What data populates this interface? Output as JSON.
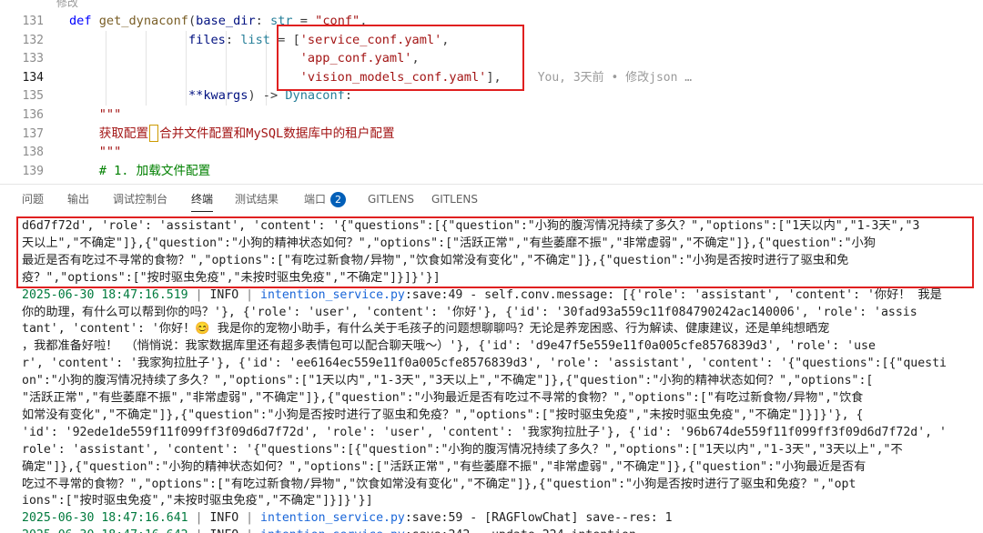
{
  "editor": {
    "top_fragment": "修改",
    "lines": [
      {
        "no": "131",
        "active": false,
        "tokens": [
          {
            "t": "def ",
            "c": "kw"
          },
          {
            "t": "get_dynaconf",
            "c": "fn"
          },
          {
            "t": "(",
            "c": "punc"
          },
          {
            "t": "base_dir",
            "c": "param"
          },
          {
            "t": ": ",
            "c": "punc"
          },
          {
            "t": "str",
            "c": "type"
          },
          {
            "t": " = ",
            "c": "punc"
          },
          {
            "t": "\"conf\"",
            "c": "str"
          },
          {
            "t": ",",
            "c": "punc"
          }
        ]
      },
      {
        "no": "132",
        "active": false,
        "tokens": [
          {
            "t": "                files",
            "c": "param"
          },
          {
            "t": ": ",
            "c": "punc"
          },
          {
            "t": "list",
            "c": "type"
          },
          {
            "t": " = ",
            "c": "punc"
          },
          {
            "t": "[",
            "c": "punc"
          },
          {
            "t": "'service_conf.yaml'",
            "c": "str"
          },
          {
            "t": ",",
            "c": "punc"
          }
        ]
      },
      {
        "no": "133",
        "active": false,
        "tokens": [
          {
            "t": "                               ",
            "c": "punc"
          },
          {
            "t": "'app_conf.yaml'",
            "c": "str"
          },
          {
            "t": ",",
            "c": "punc"
          }
        ]
      },
      {
        "no": "134",
        "active": true,
        "tokens": [
          {
            "t": "                               ",
            "c": "punc"
          },
          {
            "t": "'vision_models_conf.yaml'",
            "c": "str"
          },
          {
            "t": "],",
            "c": "punc"
          }
        ],
        "blame": "You, 3天前 • 修改json …"
      },
      {
        "no": "135",
        "active": false,
        "tokens": [
          {
            "t": "                ",
            "c": "punc"
          },
          {
            "t": "**kwargs",
            "c": "param"
          },
          {
            "t": ") -> ",
            "c": "punc"
          },
          {
            "t": "Dynaconf",
            "c": "type"
          },
          {
            "t": ":",
            "c": "punc"
          }
        ]
      },
      {
        "no": "136",
        "active": false,
        "tokens": [
          {
            "t": "    \"\"\"",
            "c": "doc"
          }
        ]
      },
      {
        "no": "137",
        "active": false,
        "tokens": [
          {
            "t": "    获取配置",
            "c": "doc"
          },
          {
            "t": "CURSOR",
            "c": "cursor"
          },
          {
            "t": "合并文件配置和MySQL数据库中的租户配置",
            "c": "doc"
          }
        ]
      },
      {
        "no": "138",
        "active": false,
        "tokens": [
          {
            "t": "    \"\"\"",
            "c": "doc"
          }
        ]
      },
      {
        "no": "139",
        "active": false,
        "tokens": [
          {
            "t": "    # 1. 加载文件配置",
            "c": "cmt"
          }
        ]
      }
    ]
  },
  "panel_tabs": [
    {
      "label": "问题",
      "active": false
    },
    {
      "label": "输出",
      "active": false
    },
    {
      "label": "调试控制台",
      "active": false
    },
    {
      "label": "终端",
      "active": true
    },
    {
      "label": "测试结果",
      "active": false
    },
    {
      "label": "端口",
      "active": false,
      "badge": "2"
    },
    {
      "label": "GITLENS",
      "active": false
    },
    {
      "label": "GITLENS",
      "active": false
    }
  ],
  "terminal": {
    "lines": [
      [
        {
          "t": "d6d7f72d', 'role': 'assistant', 'content': '{\"questions\":[{\"question\":\"小狗的腹泻情况持续了多久？\",\"options\":[\"1天以内\",\"1-3天\",\"3"
        }
      ],
      [
        {
          "t": "天以上\",\"不确定\"]},{\"question\":\"小狗的精神状态如何？\",\"options\":[\"活跃正常\",\"有些萎靡不振\",\"非常虚弱\",\"不确定\"]},{\"question\":\"小狗"
        }
      ],
      [
        {
          "t": "最近是否有吃过不寻常的食物？\",\"options\":[\"有吃过新食物/异物\",\"饮食如常没有变化\",\"不确定\"]},{\"question\":\"小狗是否按时进行了驱虫和免"
        }
      ],
      [
        {
          "t": "疫？\",\"options\":[\"按时驱虫免疫\",\"未按时驱虫免疫\",\"不确定\"]}]}'}]"
        }
      ],
      [
        {
          "t": "2025-06-30 18:47:16.519",
          "c": "green"
        },
        {
          "t": " | ",
          "c": "gray"
        },
        {
          "t": "INFO"
        },
        {
          "t": " | ",
          "c": "gray"
        },
        {
          "t": "intention_service.py",
          "c": "blue"
        },
        {
          "t": ":save:49 - self.conv.message: [{'role': 'assistant', 'content': '你好！ 我是"
        }
      ],
      [
        {
          "t": "你的助理，有什么可以帮到你的吗？'}, {'role': 'user', 'content': '你好'}, {'id': '30fad93a559c11f084790242ac140006', 'role': 'assis"
        }
      ],
      [
        {
          "t": "tant', 'content': '你好！😊 我是你的宠物小助手，有什么关于毛孩子的问题想聊聊吗？无论是养宠困惑、行为解读、健康建议，还是单纯想晒宠"
        }
      ],
      [
        {
          "t": "，我都准备好啦！ （悄悄说：我家数据库里还有超多表情包可以配合聊天哦～）'}, {'id': 'd9e47f5e559e11f0a005cfe8576839d3', 'role': 'use"
        }
      ],
      [
        {
          "t": "r', 'content': '我家狗拉肚子'}, {'id': 'ee6164ec559e11f0a005cfe8576839d3', 'role': 'assistant', 'content': '{\"questions\":[{\"questi"
        }
      ],
      [
        {
          "t": "on\":\"小狗的腹泻情况持续了多久？\",\"options\":[\"1天以内\",\"1-3天\",\"3天以上\",\"不确定\"]},{\"question\":\"小狗的精神状态如何？\",\"options\":["
        }
      ],
      [
        {
          "t": "\"活跃正常\",\"有些萎靡不振\",\"非常虚弱\",\"不确定\"]},{\"question\":\"小狗最近是否有吃过不寻常的食物？\",\"options\":[\"有吃过新食物/异物\",\"饮食"
        }
      ],
      [
        {
          "t": "如常没有变化\",\"不确定\"]},{\"question\":\"小狗是否按时进行了驱虫和免疫？\",\"options\":[\"按时驱虫免疫\",\"未按时驱虫免疫\",\"不确定\"]}]}'}, {"
        }
      ],
      [
        {
          "t": "'id': '92ede1de559f11f099ff3f09d6d7f72d', 'role': 'user', 'content': '我家狗拉肚子'}, {'id': '96b674de559f11f099ff3f09d6d7f72d', '"
        }
      ],
      [
        {
          "t": "role': 'assistant', 'content': '{\"questions\":[{\"question\":\"小狗的腹泻情况持续了多久？\",\"options\":[\"1天以内\",\"1-3天\",\"3天以上\",\"不"
        }
      ],
      [
        {
          "t": "确定\"]},{\"question\":\"小狗的精神状态如何？\",\"options\":[\"活跃正常\",\"有些萎靡不振\",\"非常虚弱\",\"不确定\"]},{\"question\":\"小狗最近是否有"
        }
      ],
      [
        {
          "t": "吃过不寻常的食物？\",\"options\":[\"有吃过新食物/异物\",\"饮食如常没有变化\",\"不确定\"]},{\"question\":\"小狗是否按时进行了驱虫和免疫？\",\"opt"
        }
      ],
      [
        {
          "t": "ions\":[\"按时驱虫免疫\",\"未按时驱虫免疫\",\"不确定\"]}]}'}]"
        }
      ],
      [
        {
          "t": "2025-06-30 18:47:16.641",
          "c": "green"
        },
        {
          "t": " | ",
          "c": "gray"
        },
        {
          "t": "INFO"
        },
        {
          "t": " | ",
          "c": "gray"
        },
        {
          "t": "intention_service.py",
          "c": "blue"
        },
        {
          "t": ":save:59 - [RAGFlowChat] save--res: 1"
        }
      ],
      [
        {
          "t": "2025-06-30 18:47:16.642",
          "c": "green"
        },
        {
          "t": " | ",
          "c": "gray"
        },
        {
          "t": "INFO"
        },
        {
          "t": " | ",
          "c": "gray"
        },
        {
          "t": "intention_service.py",
          "c": "blue"
        },
        {
          "t": ":save:242 - update 224 intention"
        }
      ]
    ]
  }
}
